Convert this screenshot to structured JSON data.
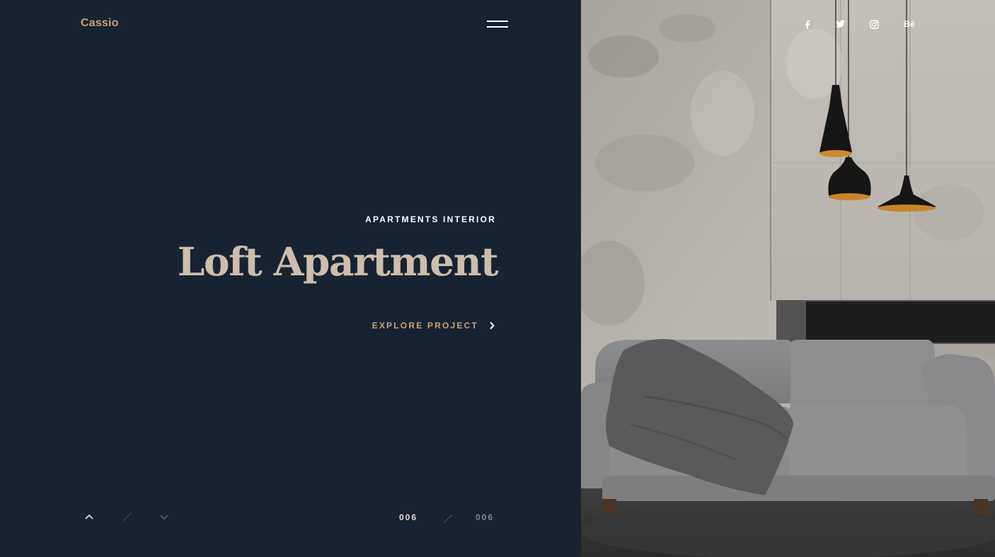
{
  "brand": {
    "name": "Cassio"
  },
  "hero": {
    "category": "APARTMENTS INTERIOR",
    "title": "Loft Apartment",
    "cta_label": "EXPLORE PROJECT"
  },
  "pagination": {
    "current": "006",
    "total": "006"
  },
  "social": [
    {
      "name": "facebook",
      "label": "f"
    },
    {
      "name": "twitter",
      "label": "twitter"
    },
    {
      "name": "instagram",
      "label": "instagram"
    },
    {
      "name": "behance",
      "label": "Bē"
    }
  ],
  "colors": {
    "panel_bg": "#182332",
    "accent": "#c9a37a",
    "title": "#cdbdad"
  },
  "icons": [
    "menu-icon",
    "chevron-right-icon",
    "chevron-up-icon",
    "chevron-down-icon",
    "facebook-icon",
    "twitter-icon",
    "instagram-icon",
    "behance-icon"
  ]
}
